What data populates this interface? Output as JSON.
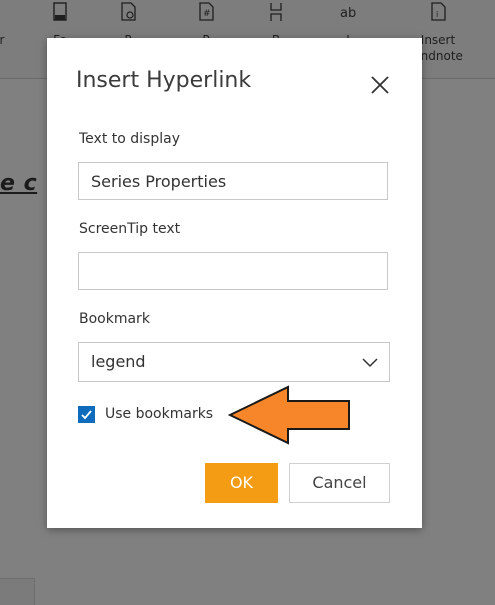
{
  "ribbon": {
    "items": [
      {
        "label": "r"
      },
      {
        "label": "Fo"
      },
      {
        "label": "P"
      },
      {
        "label": "P"
      },
      {
        "label": "B"
      },
      {
        "label": "I"
      },
      {
        "label": "Insert\nEndnote"
      }
    ]
  },
  "document": {
    "visible_text": "ie c"
  },
  "dialog": {
    "title": "Insert Hyperlink",
    "text_to_display": {
      "label": "Text to display",
      "value": "Series Properties"
    },
    "screentip": {
      "label": "ScreenTip text",
      "value": ""
    },
    "bookmark": {
      "label": "Bookmark",
      "selected": "legend"
    },
    "use_bookmarks": {
      "label": "Use bookmarks",
      "checked": true
    },
    "ok_label": "OK",
    "cancel_label": "Cancel"
  },
  "colors": {
    "ok_button": "#f39c14",
    "checkbox": "#0f6cbd",
    "arrow_fill": "#f7862a"
  },
  "icons": [
    "document-icon",
    "settings-page-icon",
    "hash-page-icon",
    "bookmark-icon",
    "ab-icon",
    "endnote-icon",
    "close-icon",
    "chevron-down-icon",
    "checkmark-icon",
    "arrow-left-annotation"
  ]
}
